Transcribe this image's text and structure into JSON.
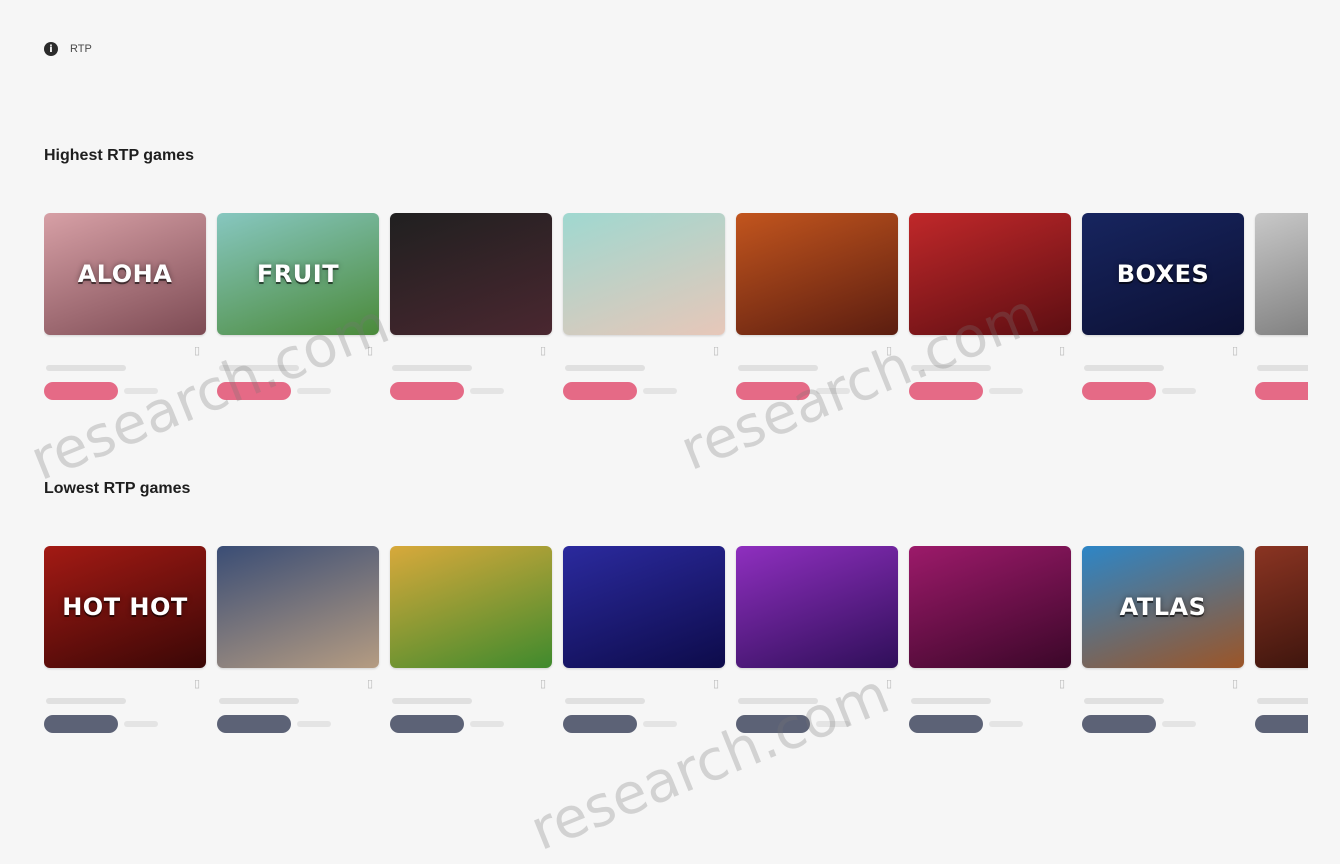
{
  "info_bar": {
    "icon": "info-icon",
    "text": "RTP"
  },
  "sections": [
    {
      "title": "Highest RTP games",
      "subtitle": "",
      "badge_style": "high",
      "games": [
        {
          "thumb_text": "ALOHA",
          "colors": [
            "#d7a0a6",
            "#7d4b54"
          ],
          "name": "",
          "rtp": ""
        },
        {
          "thumb_text": "FRUIT",
          "colors": [
            "#87c7c0",
            "#4b8a3a"
          ],
          "name": "",
          "rtp": ""
        },
        {
          "thumb_text": "",
          "colors": [
            "#202020",
            "#4a2730"
          ],
          "name": "",
          "rtp": ""
        },
        {
          "thumb_text": "",
          "colors": [
            "#9fd8d0",
            "#e7c7b9"
          ],
          "name": "",
          "rtp": ""
        },
        {
          "thumb_text": "",
          "colors": [
            "#c2551e",
            "#5b1d10"
          ],
          "name": "",
          "rtp": ""
        },
        {
          "thumb_text": "",
          "colors": [
            "#c0282a",
            "#5d0e12"
          ],
          "name": "",
          "rtp": ""
        },
        {
          "thumb_text": "BOXES",
          "colors": [
            "#17255f",
            "#0c1033"
          ],
          "name": "",
          "rtp": ""
        },
        {
          "thumb_text": "",
          "colors": [
            "#c8c8c8",
            "#6e6e6e"
          ],
          "name": "",
          "rtp": ""
        }
      ]
    },
    {
      "title": "Lowest RTP games",
      "subtitle": "",
      "badge_style": "low",
      "games": [
        {
          "thumb_text": "HOT HOT",
          "colors": [
            "#a31a14",
            "#3a0706"
          ],
          "name": "",
          "rtp": ""
        },
        {
          "thumb_text": "",
          "colors": [
            "#3a4d75",
            "#b59c82"
          ],
          "name": "",
          "rtp": ""
        },
        {
          "thumb_text": "",
          "colors": [
            "#d8a93b",
            "#3f8a2d"
          ],
          "name": "",
          "rtp": ""
        },
        {
          "thumb_text": "",
          "colors": [
            "#2b2a9e",
            "#0d0b4a"
          ],
          "name": "",
          "rtp": ""
        },
        {
          "thumb_text": "",
          "colors": [
            "#8f2fbf",
            "#2f0f59"
          ],
          "name": "",
          "rtp": ""
        },
        {
          "thumb_text": "",
          "colors": [
            "#9c1a6a",
            "#3b0729"
          ],
          "name": "",
          "rtp": ""
        },
        {
          "thumb_text": "ATLAS",
          "colors": [
            "#2d86c7",
            "#9c5527"
          ],
          "name": "",
          "rtp": ""
        },
        {
          "thumb_text": "",
          "colors": [
            "#8a3422",
            "#2a0d08"
          ],
          "name": "",
          "rtp": ""
        }
      ]
    }
  ],
  "watermarks": [
    "research.com",
    "research.com",
    "research.com"
  ],
  "colors": {
    "high_badge": "#e56a86",
    "low_badge": "#5c6276",
    "background": "#f6f6f6"
  }
}
